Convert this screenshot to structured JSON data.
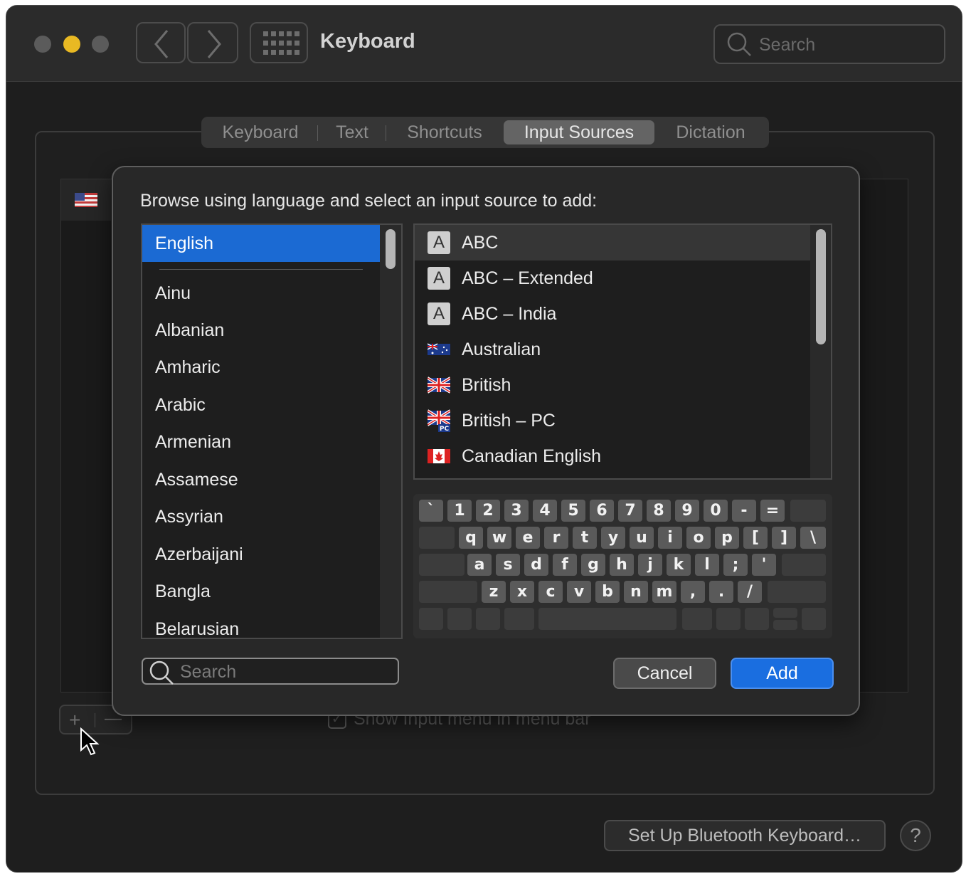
{
  "window": {
    "title": "Keyboard",
    "search_placeholder": "Search",
    "traffic_lights": {
      "close": "#5b5b5b",
      "minimize": "#e9b923",
      "zoom": "#5b5b5b"
    }
  },
  "tabs": [
    {
      "label": "Keyboard",
      "active": false
    },
    {
      "label": "Text",
      "active": false
    },
    {
      "label": "Shortcuts",
      "active": false
    },
    {
      "label": "Input Sources",
      "active": true
    },
    {
      "label": "Dictation",
      "active": false
    }
  ],
  "background": {
    "show_menu_label": "Show Input menu in menu bar",
    "bluetooth_button": "Set Up Bluetooth Keyboard…",
    "help_button": "?",
    "plus": "+",
    "minus": "—"
  },
  "sheet": {
    "prompt": "Browse using language and select an input source to add:",
    "languages": [
      "English",
      "Ainu",
      "Albanian",
      "Amharic",
      "Arabic",
      "Armenian",
      "Assamese",
      "Assyrian",
      "Azerbaijani",
      "Bangla",
      "Belarusian"
    ],
    "selected_language": "English",
    "sources": [
      {
        "label": "ABC",
        "icon": "letter-a-icon",
        "letter": "A"
      },
      {
        "label": "ABC – Extended",
        "icon": "letter-a-icon",
        "letter": "A"
      },
      {
        "label": "ABC – India",
        "icon": "letter-a-icon",
        "letter": "A"
      },
      {
        "label": "Australian",
        "icon": "australia-flag-icon"
      },
      {
        "label": "British",
        "icon": "uk-flag-icon"
      },
      {
        "label": "British – PC",
        "icon": "uk-pc-flag-icon",
        "badge": "PC"
      },
      {
        "label": "Canadian English",
        "icon": "canada-flag-icon"
      }
    ],
    "keyboard_rows": [
      [
        "`",
        "1",
        "2",
        "3",
        "4",
        "5",
        "6",
        "7",
        "8",
        "9",
        "0",
        "-",
        "="
      ],
      [
        "q",
        "w",
        "e",
        "r",
        "t",
        "y",
        "u",
        "i",
        "o",
        "p",
        "[",
        "]",
        "\\"
      ],
      [
        "a",
        "s",
        "d",
        "f",
        "g",
        "h",
        "j",
        "k",
        "l",
        ";",
        "'"
      ],
      [
        "z",
        "x",
        "c",
        "v",
        "b",
        "n",
        "m",
        ",",
        ".",
        "/"
      ]
    ],
    "search_placeholder": "Search",
    "cancel_label": "Cancel",
    "add_label": "Add",
    "accent": "#1b6ad3"
  }
}
